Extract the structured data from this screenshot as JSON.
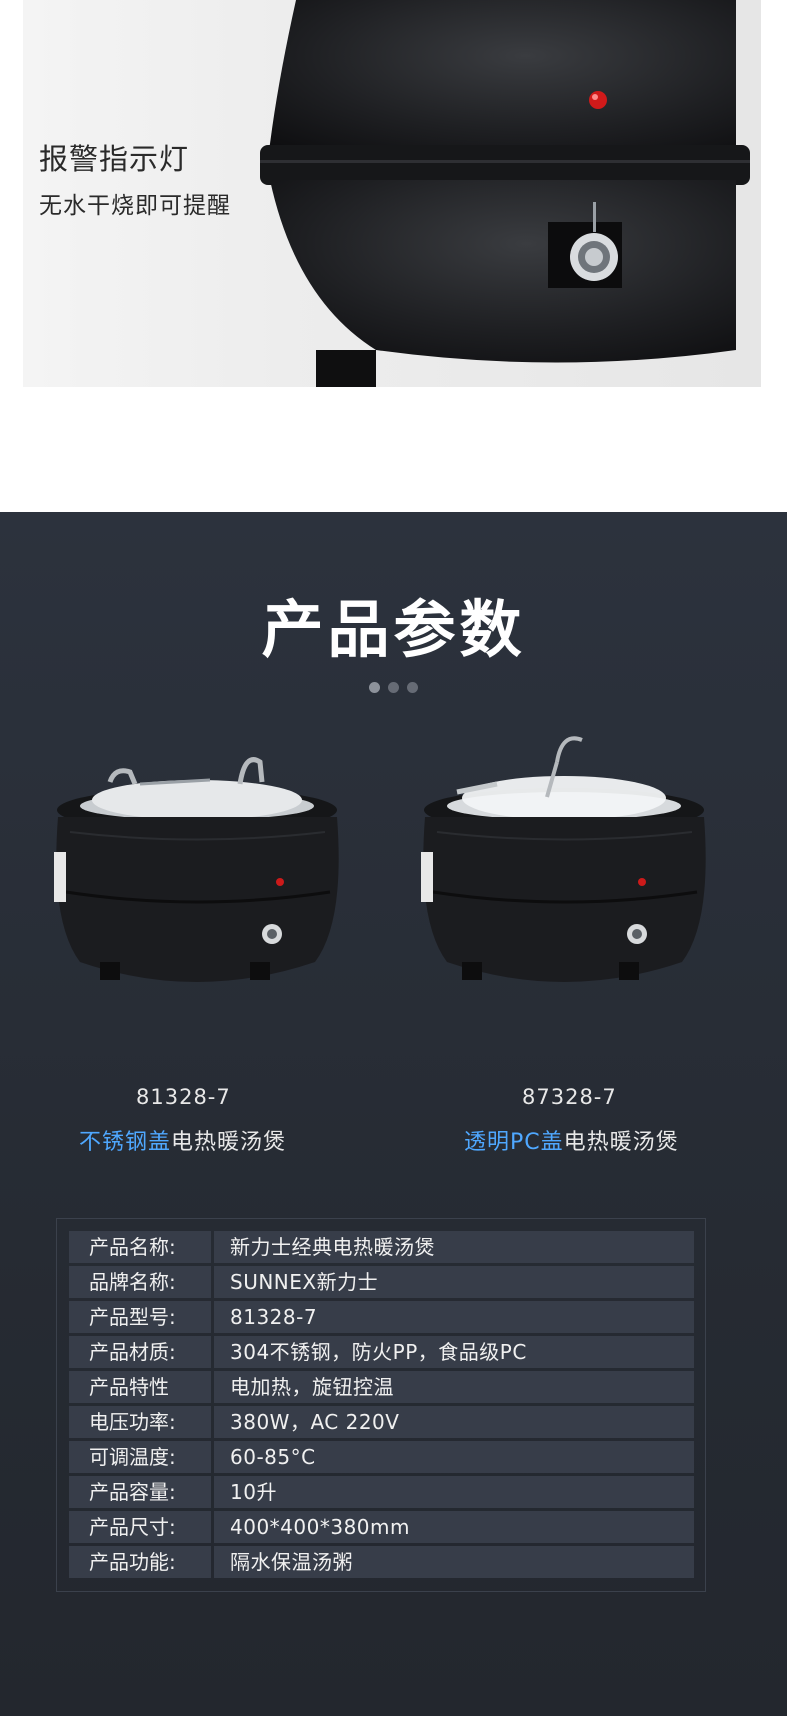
{
  "hero": {
    "title": "报警指示灯",
    "subtitle": "无水干烧即可提醒"
  },
  "params": {
    "title": "产品参数",
    "dots": 3,
    "products": [
      {
        "model": "81328-7",
        "highlight": "不锈钢盖",
        "desc_rest": "电热暖汤煲"
      },
      {
        "model": "87328-7",
        "highlight": "透明PC盖",
        "desc_rest": "电热暖汤煲"
      }
    ],
    "specs": [
      {
        "key": "产品名称:",
        "value": "新力士经典电热暖汤煲"
      },
      {
        "key": "品牌名称:",
        "value": "SUNNEX新力士"
      },
      {
        "key": "产品型号:",
        "value": "81328-7"
      },
      {
        "key": "产品材质:",
        "value": "304不锈钢，防火PP，食品级PC"
      },
      {
        "key": "产品特性",
        "value": "电加热，旋钮控温"
      },
      {
        "key": "电压功率:",
        "value": "380W，AC 220V"
      },
      {
        "key": "可调温度:",
        "value": "60-85°C"
      },
      {
        "key": "产品容量:",
        "value": "10升"
      },
      {
        "key": "产品尺寸:",
        "value": "400*400*380mm"
      },
      {
        "key": "产品功能:",
        "value": "隔水保温汤粥"
      }
    ]
  },
  "colors": {
    "highlight": "#4fa8ff",
    "section_bg": "#2c323d",
    "cell_bg": "#373d49"
  }
}
